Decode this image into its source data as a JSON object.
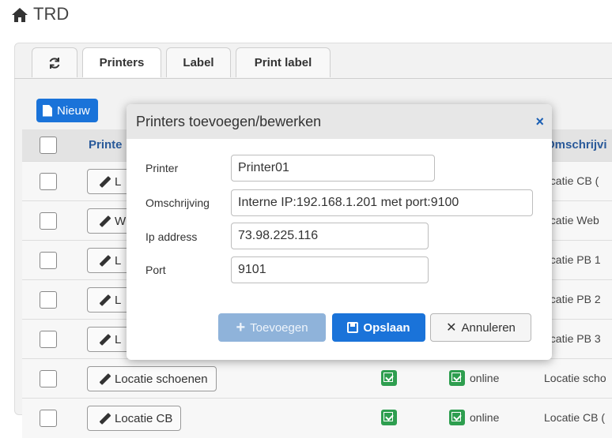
{
  "app": {
    "title": "TRD"
  },
  "tabs": {
    "refresh_icon": "refresh-icon",
    "items": [
      "Printers",
      "Label",
      "Print label"
    ]
  },
  "toolbar": {
    "new_label": "Nieuw"
  },
  "table": {
    "header_printer": "Printe",
    "header_desc": "Omschrijvi",
    "rows": [
      {
        "btn": "L",
        "desc": "ocatie CB ("
      },
      {
        "btn": "W",
        "desc": "ocatie Web"
      },
      {
        "btn": "L",
        "desc": "ocatie PB 1"
      },
      {
        "btn": "L",
        "desc": "ocatie PB 2"
      },
      {
        "btn": "L",
        "desc": "ocatie PB 3"
      },
      {
        "btn": "Locatie schoenen",
        "status": "online",
        "desc": "Locatie scho"
      },
      {
        "btn": "Locatie CB",
        "status": "online",
        "desc": "Locatie CB ("
      }
    ]
  },
  "modal": {
    "title": "Printers toevoegen/bewerken",
    "close": "×",
    "fields": {
      "printer_label": "Printer",
      "printer_value": "Printer01",
      "desc_label": "Omschrijving",
      "desc_value": "Interne IP:192.168.1.201 met port:9100",
      "ip_label": "Ip address",
      "ip_value": "73.98.225.116",
      "port_label": "Port",
      "port_value": "9101"
    },
    "buttons": {
      "add": "Toevoegen",
      "save": "Opslaan",
      "cancel": "Annuleren"
    }
  },
  "colors": {
    "primary": "#1a73d9",
    "success": "#2e9e4f",
    "close": "#1a5fb4"
  }
}
